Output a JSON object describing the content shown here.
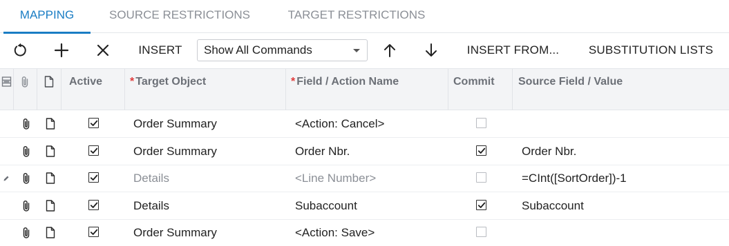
{
  "tabs": [
    {
      "label": "MAPPING",
      "active": true
    },
    {
      "label": "SOURCE RESTRICTIONS",
      "active": false
    },
    {
      "label": "TARGET RESTRICTIONS",
      "active": false
    }
  ],
  "toolbar": {
    "refresh_icon": "refresh-icon",
    "add_icon": "plus-icon",
    "delete_icon": "close-icon",
    "insert_label": "INSERT",
    "command_filter": {
      "selected": "Show All Commands"
    },
    "move_up_icon": "arrow-up-icon",
    "move_down_icon": "arrow-down-icon",
    "insert_from_label": "INSERT FROM...",
    "substitution_lists_label": "SUBSTITUTION LISTS"
  },
  "grid": {
    "columns": {
      "active": "Active",
      "target_object": "Target Object",
      "field_action_name": "Field / Action Name",
      "commit": "Commit",
      "source_field_value": "Source Field / Value"
    },
    "required_marker": "*",
    "rows": [
      {
        "active": true,
        "target_object": "Order Summary",
        "field_action": "<Action: Cancel>",
        "commit": false,
        "source_value": "",
        "editing": false
      },
      {
        "active": true,
        "target_object": "Order Summary",
        "field_action": "Order Nbr.",
        "commit": true,
        "source_value": "Order Nbr.",
        "editing": false
      },
      {
        "active": true,
        "target_object": "Details",
        "field_action": "<Line Number>",
        "commit": false,
        "source_value": "=CInt([SortOrder])-1",
        "editing": true
      },
      {
        "active": true,
        "target_object": "Details",
        "field_action": "Subaccount",
        "commit": true,
        "source_value": "Subaccount",
        "editing": false
      },
      {
        "active": true,
        "target_object": "Order Summary",
        "field_action": "<Action: Save>",
        "commit": false,
        "source_value": "",
        "editing": false
      }
    ]
  },
  "colors": {
    "accent": "#1a7dc4",
    "required": "#e03a3a",
    "header_bg": "#f3f4f6",
    "dim_text": "#8b8f96"
  }
}
